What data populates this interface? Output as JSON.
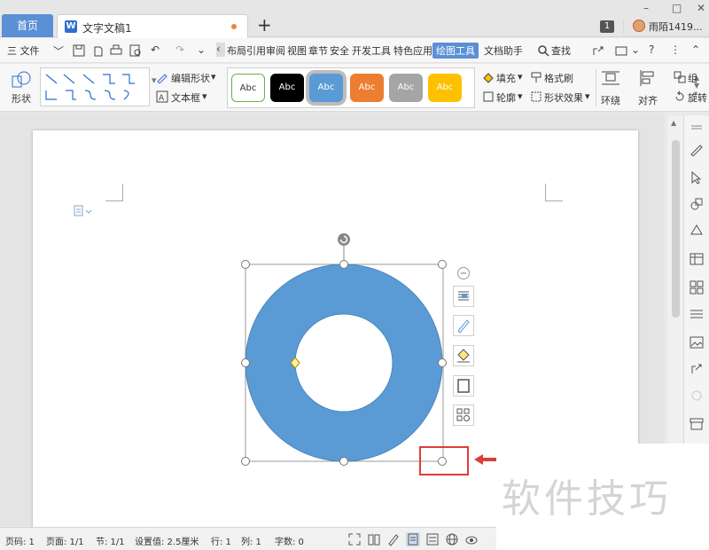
{
  "tabs": {
    "home": "首页",
    "document": "文字文稿1",
    "add": "+"
  },
  "user": {
    "badge": "1",
    "name": "雨陌1419..."
  },
  "menu": {
    "file": "三 文件",
    "items": [
      "布局",
      "引用",
      "审阅",
      "视图",
      "章节",
      "安全",
      "开发工具",
      "特色应用",
      "绘图工具",
      "文档助手"
    ],
    "active": "绘图工具",
    "search": "查找"
  },
  "ribbon": {
    "shape_label": "形状",
    "edit_shape": "编辑形状",
    "text_box": "文本框",
    "style_samples": [
      "Abc",
      "Abc",
      "Abc",
      "Abc",
      "Abc",
      "Abc"
    ],
    "fill": "填充",
    "format_painter": "格式刷",
    "outline": "轮廓",
    "shape_effects": "形状效果",
    "wrap": "环绕",
    "align": "对齐",
    "group": "组",
    "rotate": "旋转"
  },
  "colors": {
    "accent": "#5b8fd6",
    "shape_fill": "#5b9bd5",
    "highlight_red": "#e03c3c",
    "style_fills": [
      "#ffffff",
      "#000000",
      "#5b9bd5",
      "#ed7d31",
      "#a5a5a5",
      "#ffc000"
    ]
  },
  "status": {
    "page_num": "页码: 1",
    "pages": "页面: 1/1",
    "section": "节: 1/1",
    "setting": "设置值: 2.5厘米",
    "row": "行: 1",
    "col": "列: 1",
    "words": "字数: 0"
  },
  "watermark": "软件技巧"
}
